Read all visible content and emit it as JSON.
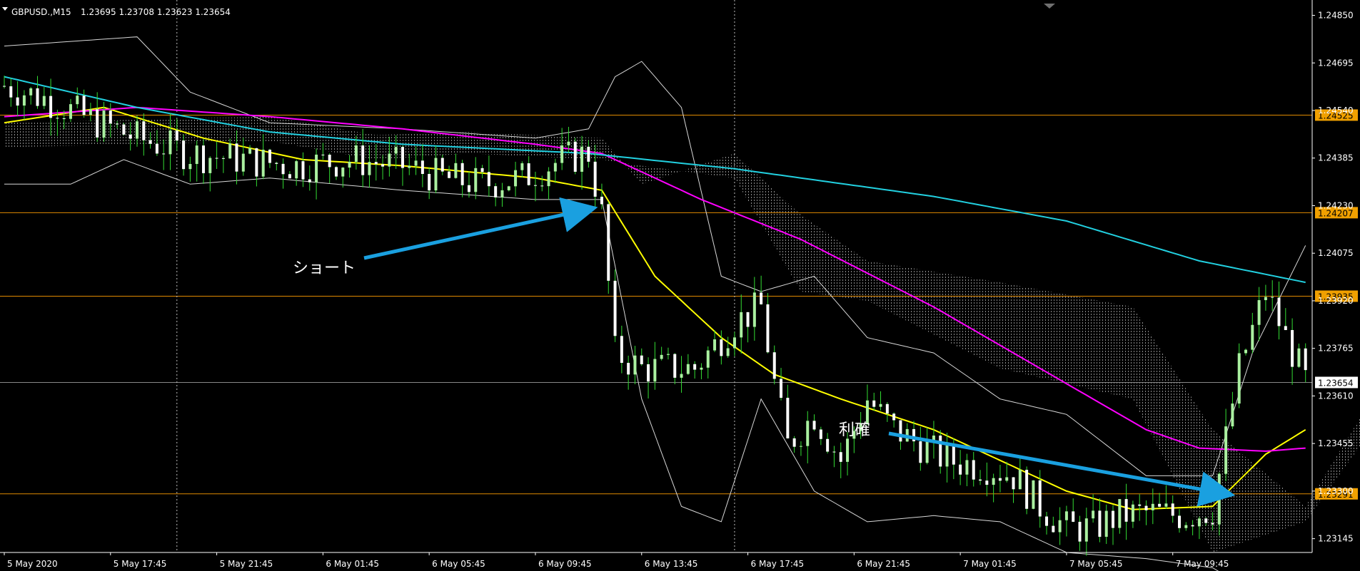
{
  "header": {
    "symbol": "GBPUSD.,M15",
    "ohlc": "1.23695 1.23708 1.23623 1.23654"
  },
  "colors": {
    "background": "#000000",
    "bull_candle": "#aaf0a0",
    "bear_candle": "#ffffff",
    "wick": "#33dd33",
    "yellow_ma": "#ffff00",
    "magenta_ma": "#ff00ff",
    "cyan_ma": "#22d0e0",
    "bollinger": "#d8d8d8",
    "cloud": "#c8c8c8",
    "level_line": "#e08a00",
    "level_badge": "#f0a000",
    "annotation_arrow": "#1aa0e0",
    "current_price_badge": "#ffffff"
  },
  "chart_data": {
    "type": "candlestick",
    "title": "GBPUSD.,M15",
    "ylim": [
      1.231,
      1.249
    ],
    "y_ticks": [
      "1.24850",
      "1.24695",
      "1.24540",
      "1.24385",
      "1.24230",
      "1.24075",
      "1.23920",
      "1.23765",
      "1.23610",
      "1.23455",
      "1.23300",
      "1.23145"
    ],
    "x_ticks": [
      "5 May 2020",
      "5 May 17:45",
      "5 May 21:45",
      "6 May 01:45",
      "6 May 05:45",
      "6 May 09:45",
      "6 May 13:45",
      "6 May 17:45",
      "6 May 21:45",
      "7 May 01:45",
      "7 May 05:45",
      "7 May 09:45"
    ],
    "separator_lines": [
      "5 May 21:45",
      "6 May 21:45"
    ],
    "horizontal_levels": [
      {
        "label": "1.24525",
        "value": 1.24525
      },
      {
        "label": "1.24207",
        "value": 1.24207
      },
      {
        "label": "1.23935",
        "value": 1.23935
      },
      {
        "label": "1.23291",
        "value": 1.23291
      }
    ],
    "current_price": {
      "label": "1.23654",
      "value": 1.23654
    },
    "series": {
      "close_path_anchors": [
        [
          0,
          1.2462
        ],
        [
          6,
          1.2458
        ],
        [
          12,
          1.2452
        ],
        [
          20,
          1.2445
        ],
        [
          28,
          1.244
        ],
        [
          36,
          1.2438
        ],
        [
          44,
          1.2436
        ],
        [
          52,
          1.2438
        ],
        [
          60,
          1.2436
        ],
        [
          66,
          1.2432
        ],
        [
          72,
          1.243
        ],
        [
          78,
          1.2432
        ],
        [
          84,
          1.2438
        ],
        [
          88,
          1.244
        ],
        [
          90,
          1.242
        ],
        [
          92,
          1.2375
        ],
        [
          96,
          1.237
        ],
        [
          104,
          1.237
        ],
        [
          110,
          1.2385
        ],
        [
          114,
          1.239
        ],
        [
          116,
          1.2365
        ],
        [
          118,
          1.2345
        ],
        [
          122,
          1.2355
        ],
        [
          126,
          1.234
        ],
        [
          130,
          1.236
        ],
        [
          134,
          1.235
        ],
        [
          138,
          1.2345
        ],
        [
          142,
          1.234
        ],
        [
          148,
          1.2338
        ],
        [
          152,
          1.2335
        ],
        [
          156,
          1.2325
        ],
        [
          160,
          1.2318
        ],
        [
          164,
          1.2318
        ],
        [
          168,
          1.2322
        ],
        [
          172,
          1.2323
        ],
        [
          178,
          1.2322
        ],
        [
          182,
          1.2324
        ],
        [
          186,
          1.237
        ],
        [
          190,
          1.2395
        ],
        [
          193,
          1.238
        ],
        [
          196,
          1.2366
        ]
      ],
      "indicators": [
        {
          "name": "yellow_ma",
          "anchors": [
            [
              0,
              1.245
            ],
            [
              15,
              1.2455
            ],
            [
              30,
              1.2445
            ],
            [
              45,
              1.2438
            ],
            [
              60,
              1.2436
            ],
            [
              80,
              1.2432
            ],
            [
              90,
              1.2428
            ],
            [
              98,
              1.24
            ],
            [
              108,
              1.238
            ],
            [
              116,
              1.2368
            ],
            [
              126,
              1.236
            ],
            [
              140,
              1.235
            ],
            [
              150,
              1.234
            ],
            [
              160,
              1.233
            ],
            [
              170,
              1.2324
            ],
            [
              182,
              1.2325
            ],
            [
              190,
              1.2342
            ],
            [
              196,
              1.235
            ]
          ]
        },
        {
          "name": "magenta_ma",
          "anchors": [
            [
              0,
              1.2452
            ],
            [
              20,
              1.2455
            ],
            [
              40,
              1.2452
            ],
            [
              60,
              1.2448
            ],
            [
              80,
              1.2443
            ],
            [
              90,
              1.244
            ],
            [
              105,
              1.2425
            ],
            [
              120,
              1.2412
            ],
            [
              140,
              1.239
            ],
            [
              160,
              1.2365
            ],
            [
              172,
              1.235
            ],
            [
              180,
              1.2344
            ],
            [
              190,
              1.2343
            ],
            [
              196,
              1.2344
            ]
          ]
        },
        {
          "name": "cyan_ma",
          "anchors": [
            [
              0,
              1.2465
            ],
            [
              20,
              1.2455
            ],
            [
              40,
              1.2447
            ],
            [
              60,
              1.2443
            ],
            [
              88,
              1.244
            ],
            [
              110,
              1.2435
            ],
            [
              140,
              1.2426
            ],
            [
              160,
              1.2418
            ],
            [
              180,
              1.2405
            ],
            [
              196,
              1.2398
            ]
          ]
        },
        {
          "name": "bollinger_upper",
          "anchors": [
            [
              0,
              1.2475
            ],
            [
              20,
              1.2478
            ],
            [
              28,
              1.246
            ],
            [
              40,
              1.245
            ],
            [
              60,
              1.2448
            ],
            [
              80,
              1.2445
            ],
            [
              88,
              1.2448
            ],
            [
              92,
              1.2465
            ],
            [
              96,
              1.247
            ],
            [
              102,
              1.2455
            ],
            [
              108,
              1.24
            ],
            [
              114,
              1.2395
            ],
            [
              122,
              1.24
            ],
            [
              130,
              1.238
            ],
            [
              140,
              1.2375
            ],
            [
              150,
              1.236
            ],
            [
              160,
              1.2355
            ],
            [
              172,
              1.2335
            ],
            [
              182,
              1.2335
            ],
            [
              188,
              1.2375
            ],
            [
              196,
              1.241
            ]
          ]
        },
        {
          "name": "bollinger_lower",
          "anchors": [
            [
              0,
              1.243
            ],
            [
              10,
              1.243
            ],
            [
              18,
              1.2438
            ],
            [
              28,
              1.243
            ],
            [
              40,
              1.2432
            ],
            [
              60,
              1.2428
            ],
            [
              80,
              1.2425
            ],
            [
              90,
              1.2425
            ],
            [
              96,
              1.236
            ],
            [
              102,
              1.2325
            ],
            [
              108,
              1.232
            ],
            [
              114,
              1.236
            ],
            [
              122,
              1.233
            ],
            [
              130,
              1.232
            ],
            [
              140,
              1.2322
            ],
            [
              150,
              1.232
            ],
            [
              160,
              1.231
            ],
            [
              172,
              1.2308
            ],
            [
              182,
              1.2305
            ],
            [
              186,
              1.23
            ]
          ]
        }
      ]
    },
    "annotations": [
      {
        "text": "ショート",
        "arrow_to": [
          89,
          1.2422
        ]
      },
      {
        "text": "利確",
        "arrow_to": [
          185,
          1.2329
        ]
      }
    ]
  }
}
